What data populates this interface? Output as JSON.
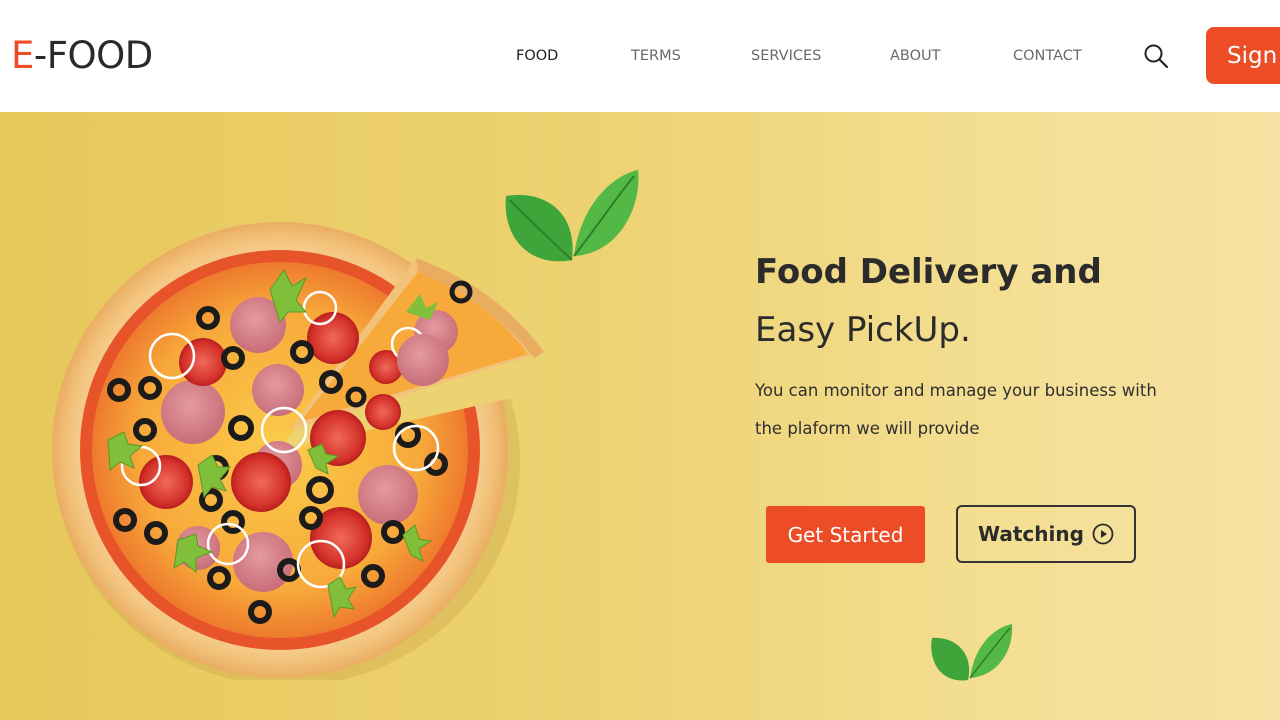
{
  "header": {
    "logo_accent": "E",
    "logo_rest": "-FOOD",
    "nav": [
      {
        "label": "FOOD",
        "active": true
      },
      {
        "label": "TERMS"
      },
      {
        "label": "SERVICES"
      },
      {
        "label": "ABOUT"
      },
      {
        "label": "CONTACT"
      }
    ],
    "search_icon": "search-icon",
    "signin_label": "Sign"
  },
  "hero": {
    "title_bold": "Food Delivery and",
    "title_light": "Easy PickUp.",
    "description": "You can monitor and manage your business with the plaform we will provide",
    "primary_button": "Get Started",
    "secondary_button": "Watching",
    "secondary_button_icon": "play-circle-icon"
  },
  "colors": {
    "accent": "#ec4c26",
    "hero_background": "#edd271",
    "text_dark": "#2b2b2b"
  }
}
